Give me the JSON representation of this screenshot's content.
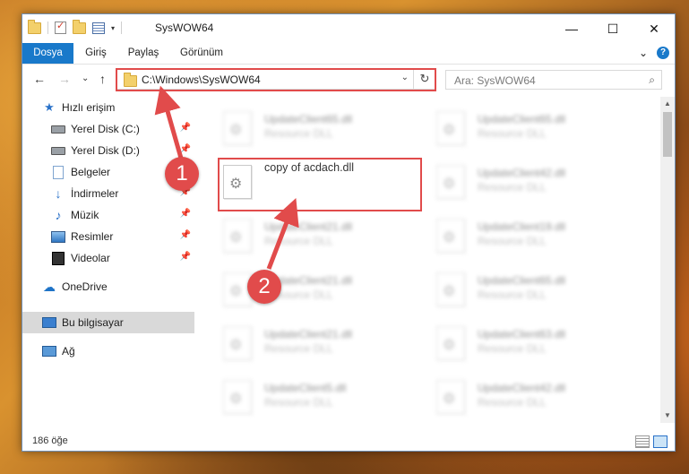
{
  "window": {
    "title": "SysWOW64"
  },
  "window_controls": {
    "minimize": "—",
    "maximize": "☐",
    "close": "✕"
  },
  "ribbon": {
    "tabs": [
      "Dosya",
      "Giriş",
      "Paylaş",
      "Görünüm"
    ],
    "help": "?",
    "expand": "⌄"
  },
  "nav": {
    "back": "←",
    "forward": "→",
    "recent": "⌄",
    "up": "↑"
  },
  "address": {
    "path": "C:\\Windows\\SysWOW64",
    "dropdown": "⌄",
    "refresh": "↻"
  },
  "search": {
    "placeholder": "Ara: SysWOW64",
    "icon": "⌕"
  },
  "sidebar": {
    "items": [
      {
        "label": "Hızlı erişim",
        "icon": "star-icon",
        "pinned": false
      },
      {
        "label": "Yerel Disk (C:)",
        "icon": "drive-icon",
        "pinned": true
      },
      {
        "label": "Yerel Disk (D:)",
        "icon": "drive-icon",
        "pinned": true
      },
      {
        "label": "Belgeler",
        "icon": "document-icon",
        "pinned": true
      },
      {
        "label": "İndirmeler",
        "icon": "download-icon",
        "pinned": true
      },
      {
        "label": "Müzik",
        "icon": "music-icon",
        "pinned": true
      },
      {
        "label": "Resimler",
        "icon": "picture-icon",
        "pinned": true
      },
      {
        "label": "Videolar",
        "icon": "video-icon",
        "pinned": true
      },
      {
        "label": "OneDrive",
        "icon": "cloud-icon",
        "pinned": false
      },
      {
        "label": "Bu bilgisayar",
        "icon": "computer-icon",
        "pinned": false
      },
      {
        "label": "Ağ",
        "icon": "network-icon",
        "pinned": false
      }
    ],
    "pin_glyph": "📌"
  },
  "files": {
    "col1": [
      {
        "name": "UpdateClient65.dll",
        "desc": "Resource DLL"
      },
      {
        "name": "copy of acdach.dll",
        "desc": ""
      },
      {
        "name": "UpdateClient21.dll",
        "desc": "Resource DLL"
      },
      {
        "name": "UpdateClient21.dll",
        "desc": "Resource DLL"
      },
      {
        "name": "UpdateClient21.dll",
        "desc": "Resource DLL"
      },
      {
        "name": "UpdateClient5.dll",
        "desc": "Resource DLL"
      }
    ],
    "col2": [
      {
        "name": "UpdateClient65.dll",
        "desc": "Resource DLL"
      },
      {
        "name": "UpdateClient42.dll",
        "desc": "Resource DLL"
      },
      {
        "name": "UpdateClient19.dll",
        "desc": "Resource DLL"
      },
      {
        "name": "UpdateClient65.dll",
        "desc": "Resource DLL"
      },
      {
        "name": "UpdateClient63.dll",
        "desc": "Resource DLL"
      },
      {
        "name": "UpdateClient42.dll",
        "desc": "Resource DLL"
      }
    ]
  },
  "status": {
    "count": "186 öğe"
  },
  "annotations": {
    "badge1": "1",
    "badge2": "2",
    "color": "#e14b4b"
  }
}
